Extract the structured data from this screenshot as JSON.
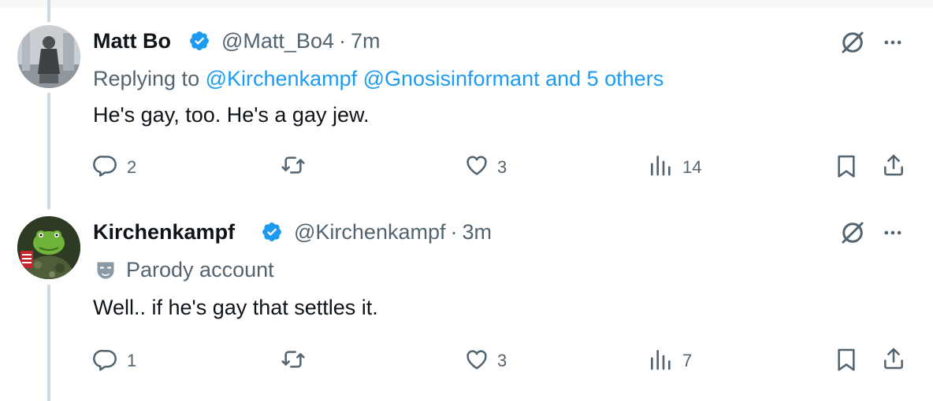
{
  "tweets": [
    {
      "name": "Matt Bo",
      "handle": "@Matt_Bo4",
      "time": "7m",
      "replying_prefix": "Replying to",
      "replying_mentions": "@Kirchenkampf @Gnosisinformant and 5 others",
      "text": "He's gay, too. He's a gay jew.",
      "replies": "2",
      "likes": "3",
      "views": "14"
    },
    {
      "name": "Kirchenkampf",
      "handle": "@Kirchenkampf",
      "time": "3m",
      "parody_label": "Parody account",
      "text": "Well.. if he's gay that settles it.",
      "replies": "1",
      "likes": "3",
      "views": "7"
    }
  ],
  "colors": {
    "accent": "#1d9bf0",
    "secondary_text": "#536471",
    "thread_line": "#cfd9de"
  },
  "icons": [
    "verified-badge-icon",
    "grok-slash-icon",
    "more-icon",
    "reply-icon",
    "retweet-icon",
    "like-icon",
    "views-icon",
    "bookmark-icon",
    "share-icon",
    "parody-mask-icon"
  ]
}
